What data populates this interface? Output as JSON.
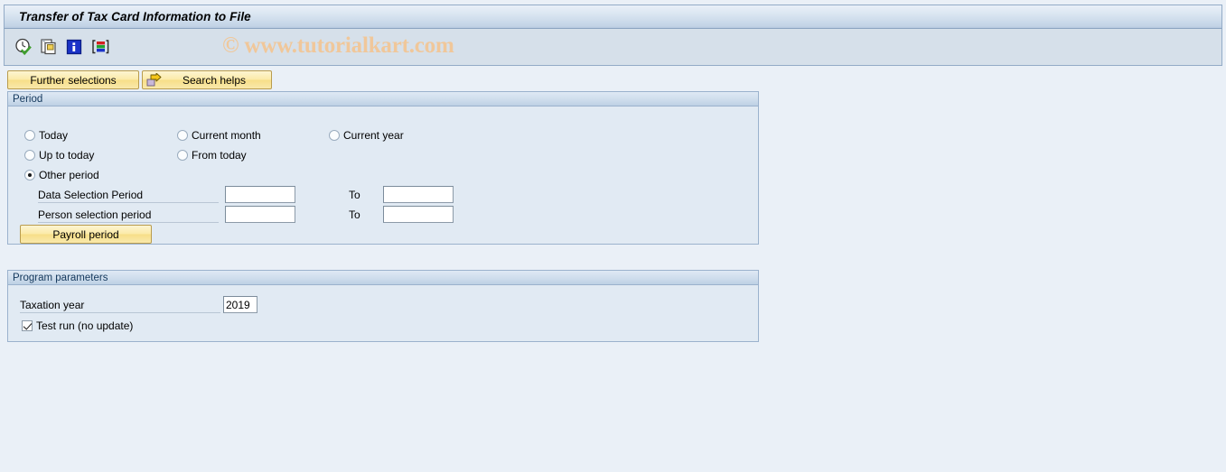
{
  "window": {
    "title": "Transfer of Tax Card Information to File",
    "watermark": "© www.tutorialkart.com"
  },
  "toolbar": {
    "icons": [
      {
        "name": "execute-clock-check-icon",
        "title": "Execute"
      },
      {
        "name": "copy-documents-icon",
        "title": "Get Variant"
      },
      {
        "name": "info-blue-icon",
        "title": "Information"
      },
      {
        "name": "multicolor-bars-icon",
        "title": "Display Variants"
      }
    ]
  },
  "buttons": {
    "further_selections": "Further selections",
    "search_helps": "Search helps",
    "payroll_period": "Payroll period"
  },
  "period": {
    "legend": "Period",
    "radios": [
      {
        "label": "Today",
        "selected": false
      },
      {
        "label": "Current month",
        "selected": false
      },
      {
        "label": "Current year",
        "selected": false
      },
      {
        "label": "Up to today",
        "selected": false
      },
      {
        "label": "From today",
        "selected": false
      },
      {
        "label": "Other period",
        "selected": true
      }
    ],
    "rows": [
      {
        "label": "Data Selection Period",
        "from_value": "",
        "to_label": "To",
        "to_value": ""
      },
      {
        "label": "Person selection period",
        "from_value": "",
        "to_label": "To",
        "to_value": ""
      }
    ]
  },
  "program_parameters": {
    "legend": "Program parameters",
    "taxation_year_label": "Taxation year",
    "taxation_year_value": "2019",
    "test_run_label": "Test run (no update)",
    "test_run_checked": true
  },
  "colors": {
    "page_background": "#eaf0f7",
    "title_bar_gradient_top": "#e9f0f8",
    "title_bar_gradient_bottom": "#b6c9de",
    "toolbar_background": "#d6e0ea",
    "group_background": "#e1eaf3",
    "group_border": "#9bb2cd",
    "button_yellow": "#f7de88",
    "button_border": "#b99c4e",
    "watermark_color": "#f0c79a",
    "legend_text": "#14385c"
  }
}
